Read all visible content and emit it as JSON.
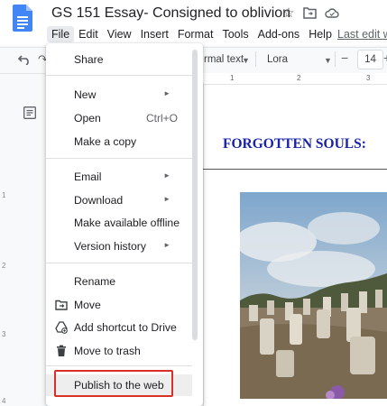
{
  "header": {
    "doc_title": "GS 151 Essay- Consigned to oblivion",
    "last_edit": "Last edit w",
    "menu": [
      "File",
      "Edit",
      "View",
      "Insert",
      "Format",
      "Tools",
      "Add-ons",
      "Help"
    ]
  },
  "toolbar": {
    "style": "rmal text",
    "font": "Lora",
    "font_size": "14",
    "minus": "−",
    "plus": "+"
  },
  "ruler": {
    "ticks": [
      "1",
      "2",
      "3"
    ]
  },
  "vruler": {
    "ticks": [
      "1",
      "2",
      "3",
      "4"
    ]
  },
  "document": {
    "heading": "FORGOTTEN SOULS:"
  },
  "file_menu": {
    "items": [
      {
        "label": "Share"
      },
      {
        "label": "New",
        "submenu": true
      },
      {
        "label": "Open",
        "shortcut": "Ctrl+O"
      },
      {
        "label": "Make a copy"
      },
      {
        "label": "Email",
        "submenu": true
      },
      {
        "label": "Download",
        "submenu": true
      },
      {
        "label": "Make available offline"
      },
      {
        "label": "Version history",
        "submenu": true
      },
      {
        "label": "Rename"
      },
      {
        "label": "Move",
        "icon": "folder-move-icon"
      },
      {
        "label": "Add shortcut to Drive",
        "icon": "drive-shortcut-icon"
      },
      {
        "label": "Move to trash",
        "icon": "trash-icon"
      },
      {
        "label": "Publish to the web"
      }
    ]
  },
  "colors": {
    "heading": "#1a23a8",
    "highlight_border": "#d93025",
    "docs_blue": "#4285f4"
  }
}
